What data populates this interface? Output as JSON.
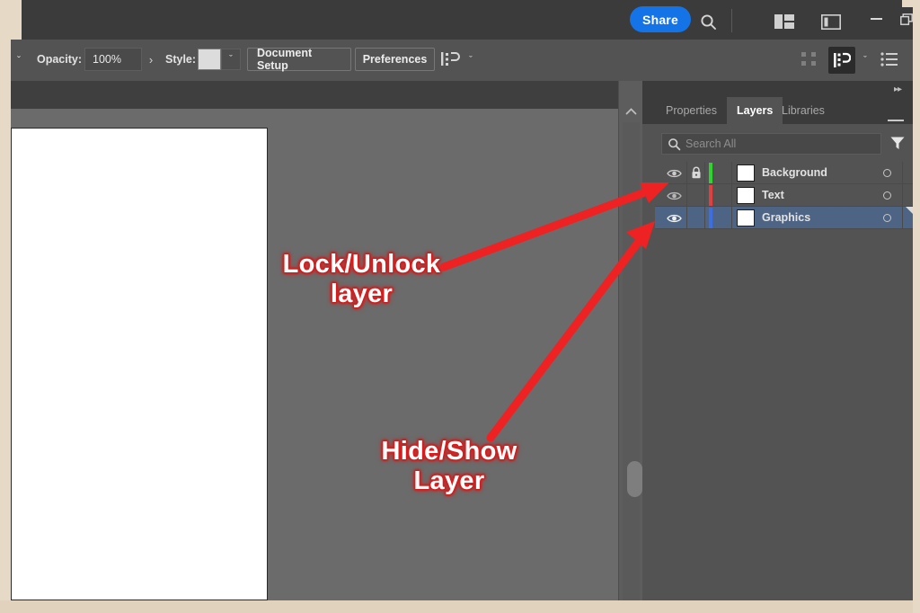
{
  "app": {
    "titlebar": {
      "share_label": "Share",
      "search_icon": "search-icon",
      "workspace_icon": "workspace-switcher-icon",
      "panel_icon": "panel-toggle-icon",
      "minimize_label": "",
      "maximize_label": "❐",
      "close_label": "✕"
    },
    "options_bar": {
      "tool_caret": "ˇ",
      "opacity_label": "Opacity:",
      "opacity_value": "100%",
      "opacity_arrow": "›",
      "style_label": "Style:",
      "style_caret": "ˇ",
      "document_setup_label": "Document Setup",
      "preferences_label": "Preferences",
      "align_caret": "ˇ",
      "right_caret": "ˇ",
      "align_icon": "align-objects-icon",
      "distribute_icon": "distribute-icon",
      "arrange_icon": "arrange-icon",
      "list_icon": "list-view-icon"
    }
  },
  "dock": {
    "collapse_icon": "▸▸",
    "tabs": [
      {
        "label": "Properties",
        "active": false
      },
      {
        "label": "Layers",
        "active": true
      },
      {
        "label": "Libraries",
        "active": false
      }
    ],
    "menu_icon": "panel-menu-icon",
    "search": {
      "placeholder": "Search All",
      "value": "",
      "icon": "search-icon",
      "filter_icon": "filter-icon"
    },
    "layers": [
      {
        "name": "Background",
        "visible": true,
        "locked": true,
        "selected": false,
        "color": "#2fd42f",
        "eye_icon": "eye-icon",
        "lock_icon": "lock-closed-icon",
        "target_icon": "target-circle-icon"
      },
      {
        "name": "Text",
        "visible": true,
        "locked": false,
        "selected": false,
        "color": "#e04040",
        "eye_icon": "eye-icon",
        "lock_icon": "",
        "target_icon": "target-circle-icon"
      },
      {
        "name": "Graphics",
        "visible": true,
        "locked": false,
        "selected": true,
        "color": "#3d6fe0",
        "eye_icon": "eye-icon",
        "lock_icon": "",
        "target_icon": "target-circle-icon"
      }
    ]
  },
  "canvas": {
    "scroll_up_icon": "chevron-up-icon",
    "scrollbar": "vertical-scrollbar"
  },
  "annotations": [
    {
      "text": "Lock/Unlock\nlayer",
      "color": "#ee2222"
    },
    {
      "text": "Hide/Show\nLayer",
      "color": "#ee2222"
    }
  ],
  "annotation_text": {
    "lock": "Lock/Unlock layer",
    "lock_line1": "Lock/Unlock",
    "lock_line2": "layer",
    "hide": "Hide/Show Layer",
    "hide_line1": "Hide/Show",
    "hide_line2": "Layer"
  },
  "colors": {
    "accent_blue": "#1473e6",
    "selection_blue": "#4d6484",
    "panel_bg": "#535353",
    "chrome_bg": "#3b3b3b",
    "canvas_bg": "#6b6b6b",
    "annotation_red": "#ee2222",
    "frame_beige": "#e6d9c5"
  }
}
